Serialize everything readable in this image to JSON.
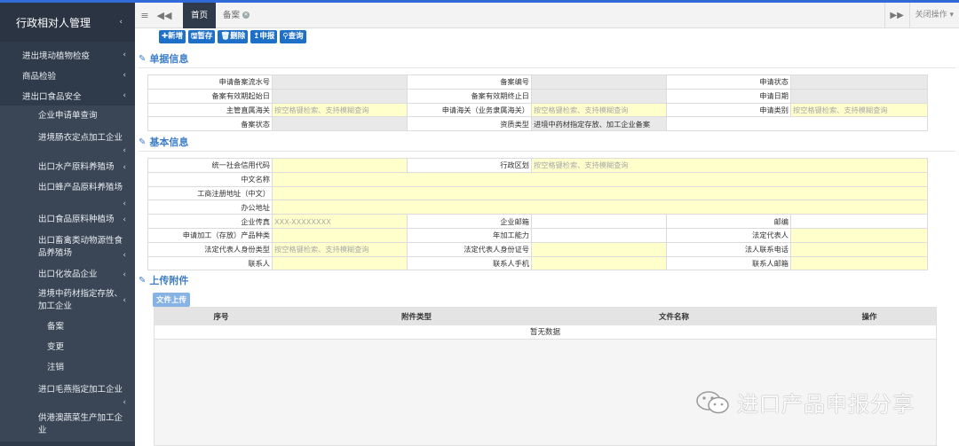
{
  "sidebar": {
    "title": "行政相对人管理",
    "items": [
      {
        "label": "进出境动植物检疫"
      },
      {
        "label": "商品检验"
      },
      {
        "label": "进出口食品安全"
      }
    ],
    "subitems": [
      {
        "label": "企业申请单查询"
      },
      {
        "label": "进境肠衣定点加工企业"
      },
      {
        "label": "出口水产原料养殖场"
      },
      {
        "label": "出口蜂产品原料养殖场"
      },
      {
        "label": "出口食品原料种植场"
      },
      {
        "label": "出口畜禽类动物源性食品养殖场"
      },
      {
        "label": "出口化妆品企业"
      },
      {
        "label": "进境中药材指定存放、加工企业"
      },
      {
        "label": "备案"
      },
      {
        "label": "变更"
      },
      {
        "label": "注销"
      },
      {
        "label": "进口毛燕指定加工企业"
      },
      {
        "label": "供港澳蔬菜生产加工企业"
      }
    ]
  },
  "tabs": {
    "home": "首页",
    "active": "备案",
    "close_ops": "关闭操作"
  },
  "toolbar": {
    "add": "新增",
    "save": "暂存",
    "delete": "删除",
    "declare": "申报",
    "query": "查询"
  },
  "sections": {
    "doc_info": "单据信息",
    "basic_info": "基本信息",
    "attachments": "上传附件"
  },
  "doc_form": {
    "serial_label": "申请备案流水号",
    "record_no_label": "备案编号",
    "apply_status_label": "申请状态",
    "valid_start_label": "备案有效期起始日",
    "valid_end_label": "备案有效期终止日",
    "apply_date_label": "申请日期",
    "customs_label": "主管直属海关",
    "customs_placeholder": "按空格键检索、支持模糊查询",
    "apply_customs_label": "申请海关（业务隶属海关）",
    "apply_customs_placeholder": "按空格键检索、支持模糊查询",
    "apply_type_label": "申请类别",
    "apply_type_placeholder": "按空格键检索、支持模糊查询",
    "record_status_label": "备案状态",
    "qual_type_label": "资质类型",
    "qual_type_value": "进境中药材指定存放、加工企业备案"
  },
  "basic_form": {
    "credit_code_label": "统一社会信用代码",
    "district_label": "行政区划",
    "district_placeholder": "按空格键检索、支持模糊查询",
    "cn_name_label": "中文名称",
    "reg_addr_label": "工商注册地址（中文）",
    "office_addr_label": "办公地址",
    "fax_label": "企业传真",
    "fax_placeholder": "XXX-XXXXXXXX",
    "email_label": "企业邮箱",
    "postcode_label": "邮编",
    "product_label": "申请加工（存放）产品种类",
    "capacity_label": "年加工能力",
    "legal_rep_label": "法定代表人",
    "legal_id_type_label": "法定代表人身份类型",
    "legal_id_type_placeholder": "按空格键检索、支持模糊查询",
    "legal_id_no_label": "法定代表人身份证号",
    "legal_phone_label": "法人联系电话",
    "contact_label": "联系人",
    "contact_mobile_label": "联系人手机",
    "contact_email_label": "联系人邮箱"
  },
  "attachments": {
    "upload_label": "文件上传",
    "columns": [
      "序号",
      "附件类型",
      "文件名称",
      "操作"
    ],
    "empty_text": "暂无数据"
  },
  "watermark": {
    "text": "进口产品申报分享"
  }
}
